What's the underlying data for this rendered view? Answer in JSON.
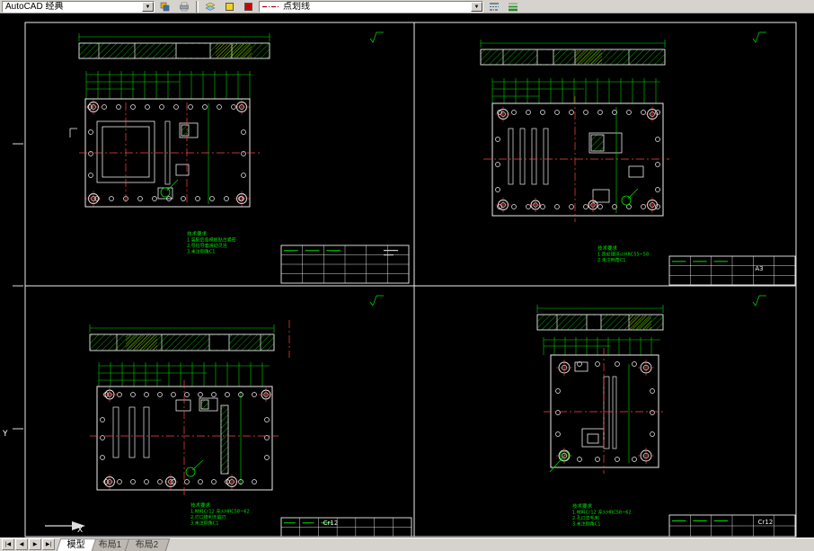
{
  "toolbar": {
    "workspace_combo": "AutoCAD 经典",
    "linetype_combo": "点划线"
  },
  "icons": {
    "dropdown": "▼"
  },
  "tab_nav": {
    "first": "|◀",
    "prev": "◀",
    "next": "▶",
    "last": "▶|"
  },
  "tabs": {
    "model": "模型",
    "layout1": "布局1",
    "layout2": "布局2"
  },
  "ucs": {
    "x_label": "X",
    "y_label": "Y"
  },
  "sheets": [
    {
      "position": "top-left",
      "notes": [
        "技术要求",
        "1.装配后各模板贴合紧密",
        "2.导柱导套滑动灵活",
        "3.未注倒角C1"
      ]
    },
    {
      "position": "top-right",
      "notes": [
        "技术要求",
        "1.热处理淬火HRC55~58",
        "2.未注倒角C1"
      ],
      "title_code": "A3"
    },
    {
      "position": "bottom-left",
      "notes": [
        "技术要求",
        "1.材料Cr12 淬火HRC58~62",
        "2.刃口锋利无崩刃",
        "3.未注倒角C1"
      ],
      "title_code": "Cr12"
    },
    {
      "position": "bottom-right",
      "notes": [
        "技术要求",
        "1.材料Cr12 淬火HRC58~62",
        "2.孔口去毛刺",
        "3.未注倒角C1"
      ],
      "title_code": "Cr12"
    }
  ]
}
